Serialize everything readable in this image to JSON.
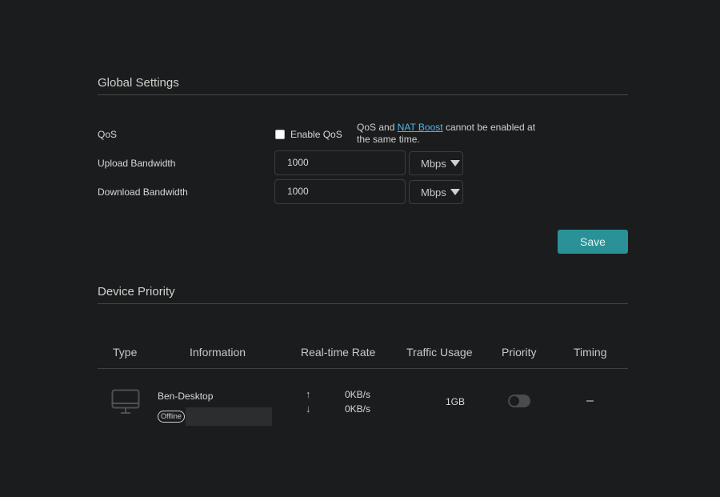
{
  "global_settings": {
    "title": "Global Settings",
    "qos": {
      "label": "QoS",
      "checkbox_label": "Enable QoS",
      "checked": false,
      "note_prefix": "QoS and ",
      "note_link": "NAT Boost",
      "note_suffix": " cannot be enabled at the same time."
    },
    "upload": {
      "label": "Upload Bandwidth",
      "value": "1000",
      "unit": "Mbps"
    },
    "download": {
      "label": "Download Bandwidth",
      "value": "1000",
      "unit": "Mbps"
    },
    "save_label": "Save",
    "accent_color": "#2a9197"
  },
  "device_priority": {
    "title": "Device Priority",
    "columns": [
      "Type",
      "Information",
      "Real-time Rate",
      "Traffic Usage",
      "Priority",
      "Timing"
    ],
    "rows": [
      {
        "type_icon": "desktop-monitor-icon",
        "name": "Ben-Desktop",
        "status": "Offline",
        "upload_rate": "0KB/s",
        "download_rate": "0KB/s",
        "traffic_usage": "1GB",
        "priority_enabled": false,
        "timing": "-"
      }
    ]
  }
}
